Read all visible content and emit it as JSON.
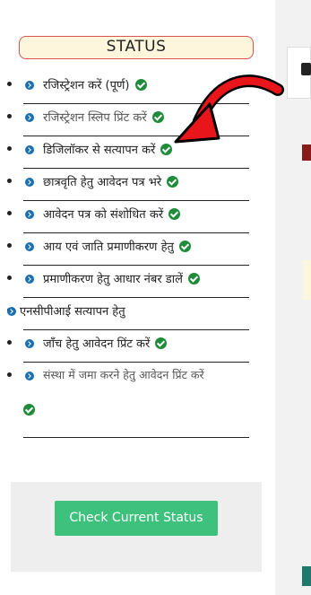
{
  "status_panel": {
    "title": "STATUS",
    "items": [
      {
        "label": "रजिस्ट्रेशन करें (पूर्ण)",
        "done": true
      },
      {
        "label": "रजिस्ट्रेशन स्लिप प्रिंट करें",
        "done": true
      },
      {
        "label": "डिजिलॉकर से सत्यापन करें",
        "done": true
      },
      {
        "label": "छात्रवृति हेतु आवेदन पत्र भरे",
        "done": true
      },
      {
        "label": "आवेदन पत्र को संशोधित करें",
        "done": true
      },
      {
        "label": "आय एवं जाति प्रमाणीकरण हेतु",
        "done": true
      },
      {
        "label": "प्रमाणीकरण हेतु आधार नंबर डालें",
        "done": true
      },
      {
        "label": "एनसीपीआई सत्यापन हेतु",
        "done": false
      },
      {
        "label": "जाँच हेतु आवेदन प्रिंट करें",
        "done": true
      },
      {
        "label": "संस्था में जमा करने हेतु आवेदन प्रिंट करें",
        "done": true
      }
    ],
    "check_button_label": "Check Current Status"
  },
  "colors": {
    "accent_green": "#3ec17c",
    "check_green": "#1e8c3a",
    "chevron_blue": "#1a6fb0",
    "arrow_red": "#e8151b",
    "title_border": "#d9534f"
  },
  "icons": {
    "item_icon": "chevron-right-circle-icon",
    "done_icon": "check-circle-icon",
    "annotation": "red-arrow-icon"
  }
}
